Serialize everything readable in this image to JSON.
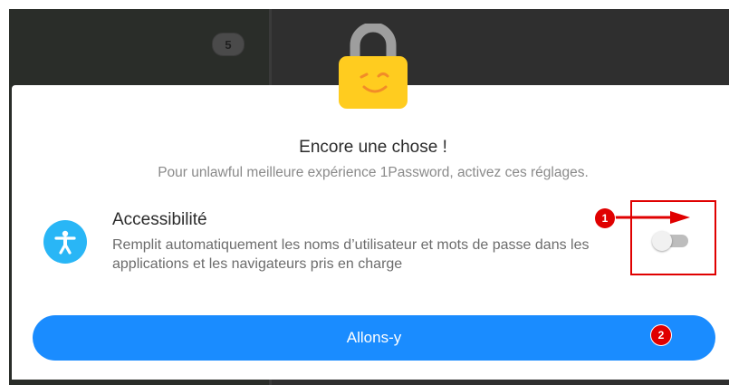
{
  "background": {
    "badge_count": "5"
  },
  "dialog": {
    "title": "Encore une chose !",
    "subtitle": "Pour unlawful meilleure expérience 1Password, activez ces réglages.",
    "accessibility": {
      "title": "Accessibilité",
      "description": "Remplit automatiquement les noms d’utilisateur et mots de passe dans les applications et les navigateurs pris en charge",
      "toggle_on": false,
      "icon": "accessibility-icon"
    },
    "primary_button_label": "Allons-y"
  },
  "annotations": {
    "marker_1": "1",
    "marker_2": "2"
  },
  "colors": {
    "accent": "#1a8cff",
    "accessibility_icon_bg": "#29b6f6",
    "lock_body": "#ffcc1f",
    "lock_shackle": "#9e9e9e",
    "annotation_red": "#e00000"
  }
}
